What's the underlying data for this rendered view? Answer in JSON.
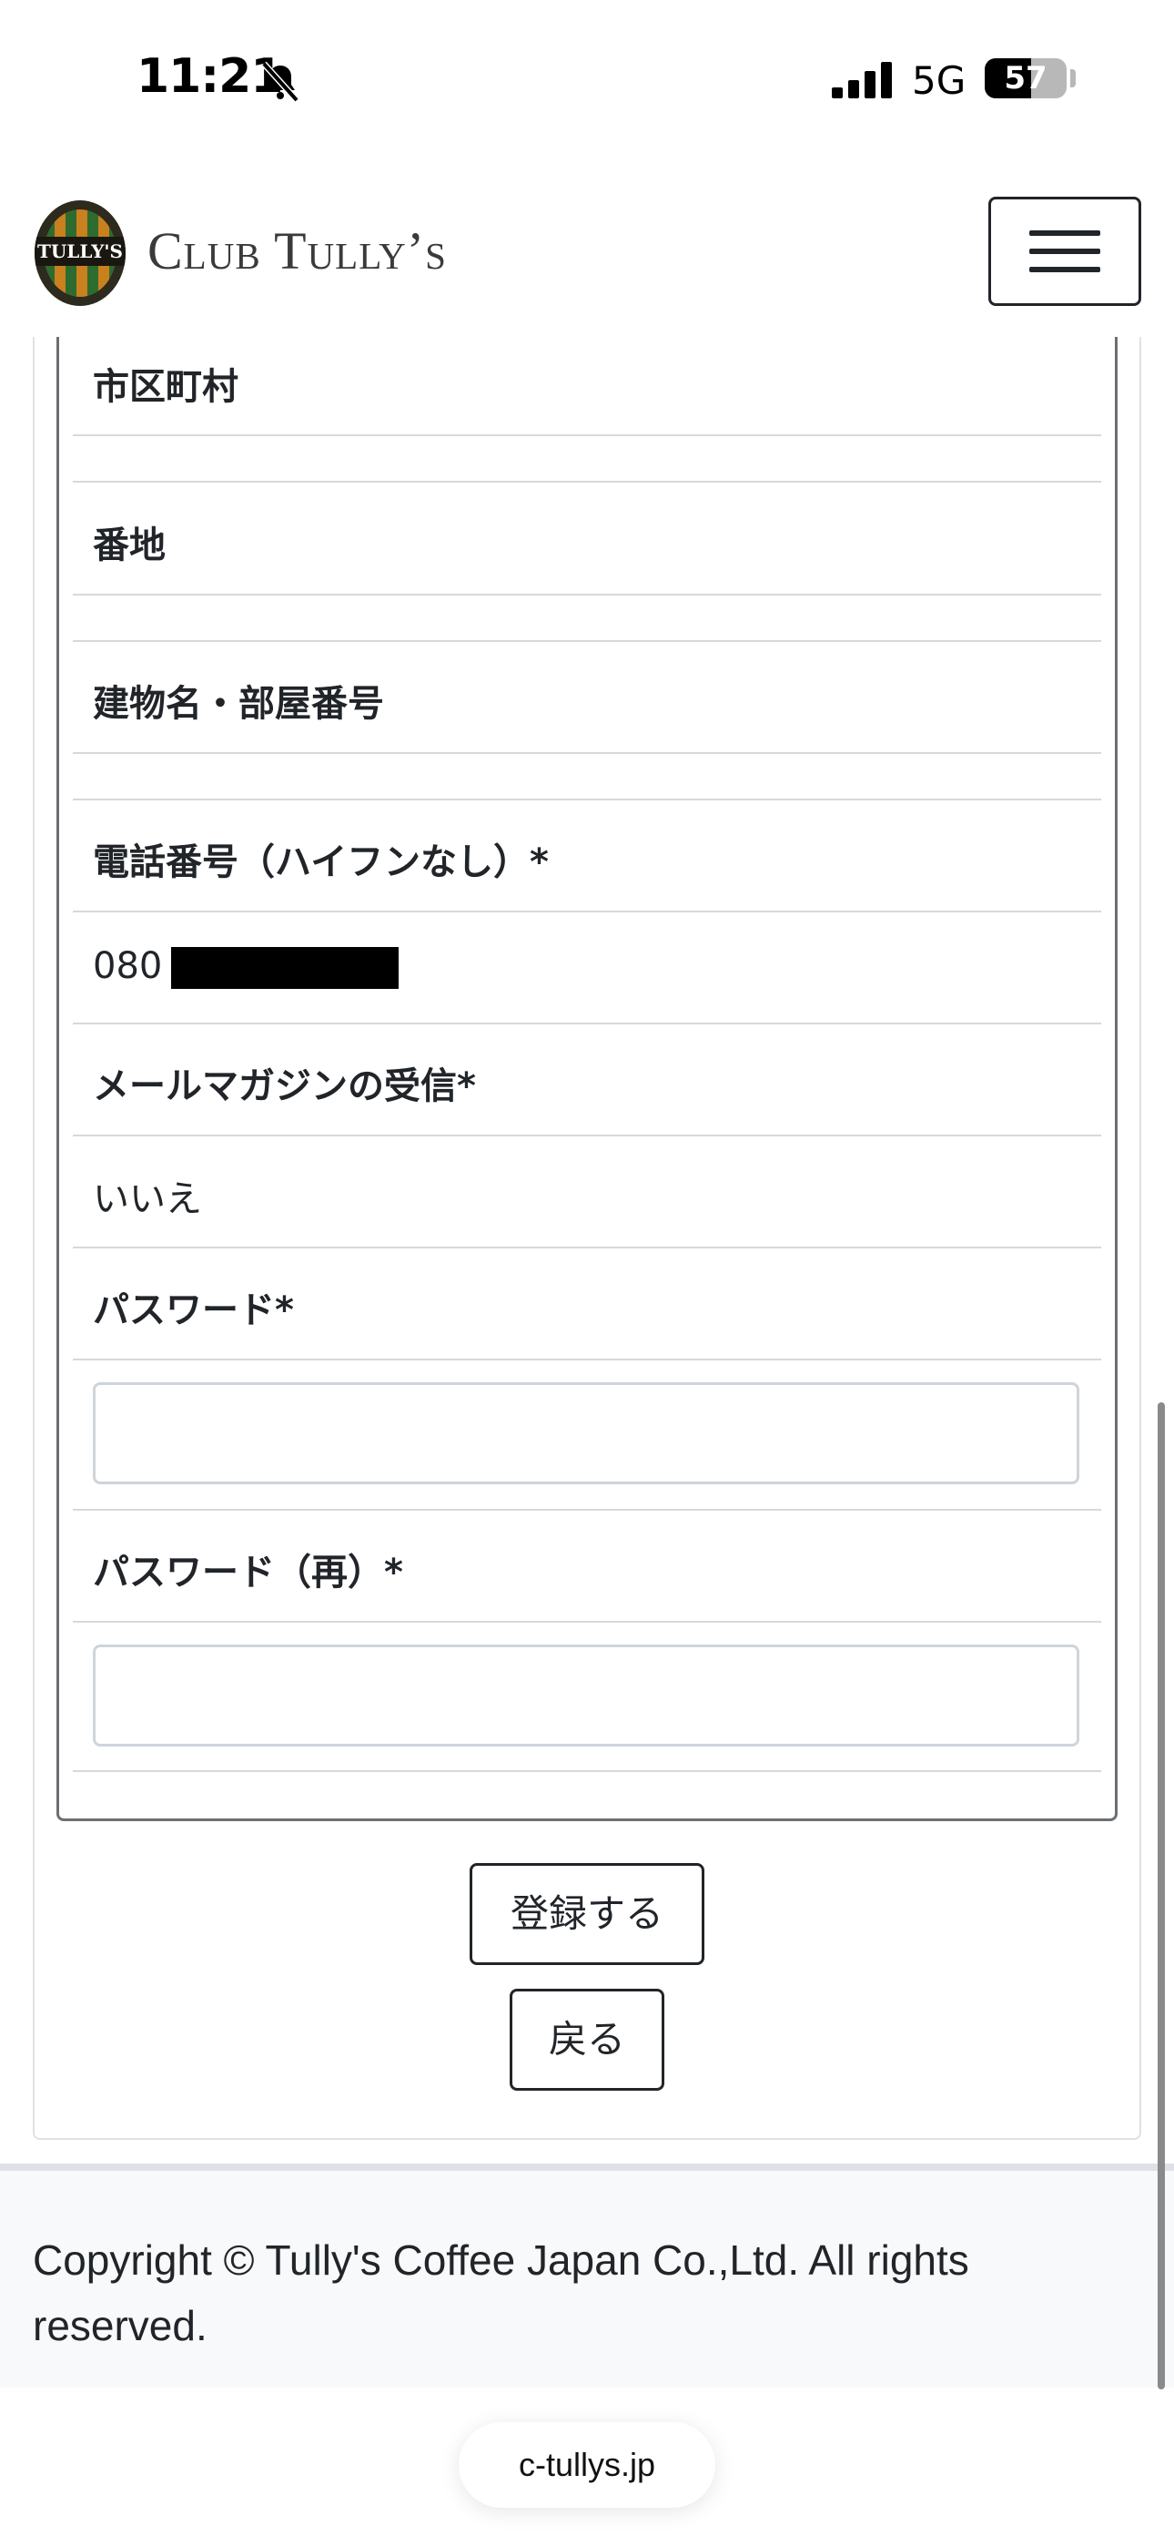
{
  "status_bar": {
    "time": "11:21",
    "network": "5G",
    "battery_level": "57",
    "battery_fraction": 0.57,
    "icons": [
      "bell-slash-icon",
      "signal-icon",
      "battery-icon"
    ]
  },
  "header": {
    "logo_text": "TULLY'S",
    "brand_name": "Club Tully’s",
    "menu_icon": "hamburger-icon"
  },
  "form": {
    "fields": [
      {
        "label": "市区町村"
      },
      {
        "label": "番地"
      },
      {
        "label": "建物名・部屋番号"
      },
      {
        "label": "電話番号（ハイフンなし）*",
        "value": "080"
      },
      {
        "label": "メールマガジンの受信*",
        "value": "いいえ"
      },
      {
        "label": "パスワード*"
      },
      {
        "label": "パスワード（再）*"
      }
    ]
  },
  "actions": {
    "register_label": "登録する",
    "back_label": "戻る"
  },
  "footer": {
    "copyright": "Copyright © Tully's Coffee Japan Co.,Ltd. All rights reserved."
  },
  "browser": {
    "url": "c-tullys.jp"
  },
  "colors": {
    "text": "#212529",
    "footer_bg": "#f8f9fa",
    "border": "#dee2e6"
  }
}
